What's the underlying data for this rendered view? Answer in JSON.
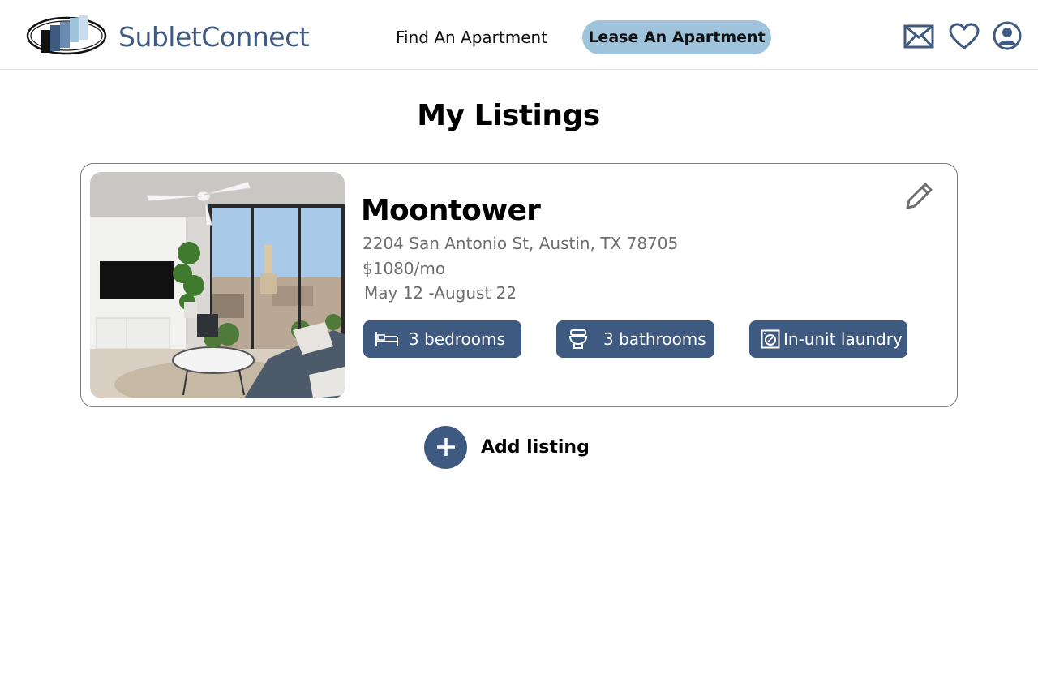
{
  "header": {
    "brand": "SubletConnect",
    "nav_find": "Find An Apartment",
    "nav_lease": "Lease An Apartment",
    "icons": [
      "mail-icon",
      "heart-icon",
      "user-icon"
    ]
  },
  "page": {
    "title": "My Listings"
  },
  "listing": {
    "name": "Moontower",
    "address": "2204 San Antonio St, Austin, TX 78705",
    "price": "$1080/mo",
    "dates": "May 12 -August 22",
    "tags": [
      {
        "label": "3 bedrooms",
        "icon": "bed-icon"
      },
      {
        "label": "3 bathrooms",
        "icon": "toilet-icon"
      },
      {
        "label": "In-unit laundry",
        "icon": "washer-icon"
      }
    ]
  },
  "actions": {
    "add_listing": "Add listing"
  },
  "colors": {
    "brand": "#3f5a80",
    "accent_pill": "#9ec3db",
    "tag_bg": "#3e5a80"
  }
}
